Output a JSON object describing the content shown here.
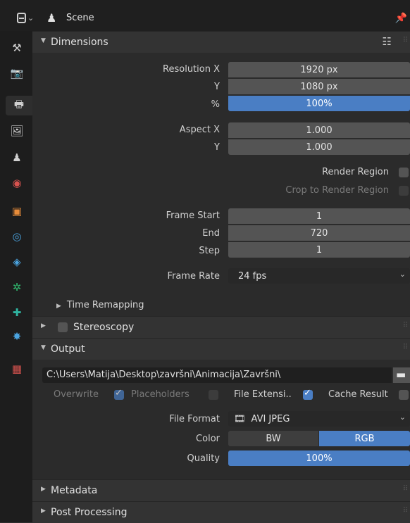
{
  "header": {
    "editor_type_icon": "properties-editor-icon",
    "scene_icon": "scene-icon",
    "scene_label": "Scene",
    "pin_icon": "pin-icon"
  },
  "sidebar": {
    "tabs": [
      {
        "name": "tool-tab",
        "glyph": "⚒",
        "color": "#d0d0d0"
      },
      {
        "name": "render-tab",
        "glyph": "📷",
        "color": "#d0d0d0"
      },
      {
        "name": "output-tab",
        "glyph": "🖶",
        "color": "#d0d0d0",
        "active": true
      },
      {
        "name": "view-layer-tab",
        "glyph": "🖼",
        "color": "#d0d0d0"
      },
      {
        "name": "scene-tab",
        "glyph": "♟",
        "color": "#d0d0d0"
      },
      {
        "name": "world-tab",
        "glyph": "◉",
        "color": "#d9534f"
      },
      {
        "name": "object-tab",
        "glyph": "▣",
        "color": "#e88c3a"
      },
      {
        "name": "modifiers-tab",
        "glyph": "◎",
        "color": "#4aa3df"
      },
      {
        "name": "particles-tab",
        "glyph": "◈",
        "color": "#4aa3df"
      },
      {
        "name": "physics-tab",
        "glyph": "✲",
        "color": "#2fb36b"
      },
      {
        "name": "constraints-tab",
        "glyph": "✚",
        "color": "#2fb3a0"
      },
      {
        "name": "object-data-tab",
        "glyph": "✸",
        "color": "#4aa3df"
      },
      {
        "name": "texture-tab",
        "glyph": "▦",
        "color": "#d9534f"
      }
    ]
  },
  "dimensions": {
    "title": "Dimensions",
    "presets_icon": "list-icon",
    "resolution_x_label": "Resolution X",
    "resolution_x": "1920 px",
    "resolution_y_label": "Y",
    "resolution_y": "1080 px",
    "resolution_pct_label": "%",
    "resolution_pct": "100%",
    "aspect_x_label": "Aspect X",
    "aspect_x": "1.000",
    "aspect_y_label": "Y",
    "aspect_y": "1.000",
    "render_region_label": "Render Region",
    "crop_label": "Crop to Render Region",
    "frame_start_label": "Frame Start",
    "frame_start": "1",
    "frame_end_label": "End",
    "frame_end": "720",
    "frame_step_label": "Step",
    "frame_step": "1",
    "frame_rate_label": "Frame Rate",
    "frame_rate": "24 fps",
    "time_remapping_label": "Time Remapping"
  },
  "stereoscopy": {
    "title": "Stereoscopy",
    "enabled": false
  },
  "output": {
    "title": "Output",
    "path": "C:\\Users\\Matija\\Desktop\\završni\\Animacija\\Završni\\",
    "folder_icon": "folder-icon",
    "overwrite_label": "Overwrite",
    "overwrite": true,
    "placeholders_label": "Placeholders",
    "placeholders": false,
    "file_extension_label": "File Extensi..",
    "file_extension": true,
    "cache_result_label": "Cache Result",
    "cache_result": false,
    "file_format_label": "File Format",
    "file_format": "AVI JPEG",
    "file_format_icon": "film-icon",
    "color_label": "Color",
    "color_bw": "BW",
    "color_rgb": "RGB",
    "color_selected": "RGB",
    "quality_label": "Quality",
    "quality": "100%"
  },
  "metadata": {
    "title": "Metadata"
  },
  "post_processing": {
    "title": "Post Processing"
  },
  "colors": {
    "accent": "#4a7ec4",
    "field": "#545454",
    "panel": "#2b2b2b",
    "header": "#333333"
  }
}
